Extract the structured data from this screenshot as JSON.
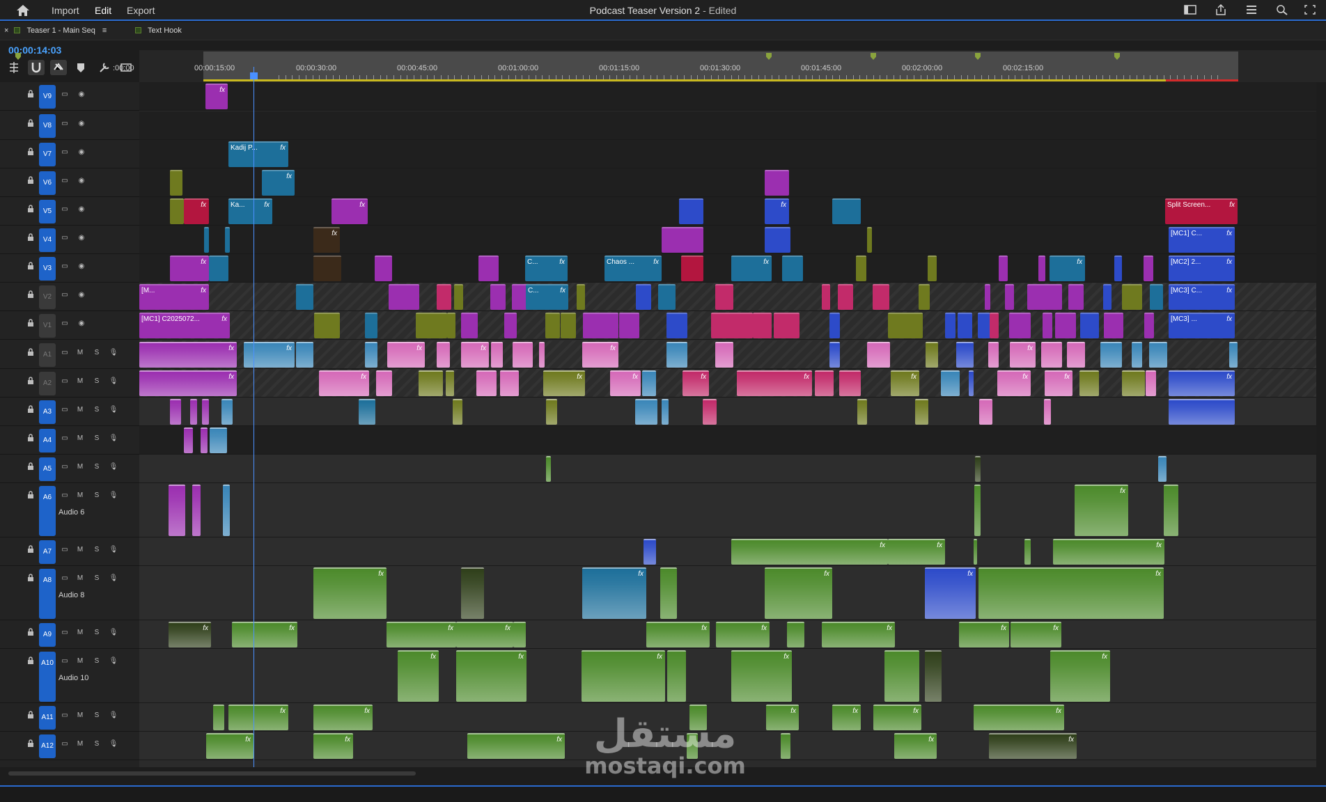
{
  "topbar": {
    "menus": [
      "Import",
      "Edit",
      "Export"
    ],
    "active_menu": "Edit",
    "title": "Podcast Teaser Version 2",
    "title_suffix": " - Edited"
  },
  "tabs": [
    {
      "label": "Teaser 1 - Main Seq",
      "active": true
    },
    {
      "label": "Text Hook",
      "active": false
    }
  ],
  "timecode": "00:00:14:03",
  "ruler_labels": [
    ":00:00",
    "00:00:15:00",
    "00:00:30:00",
    "00:00:45:00",
    "00:01:00:00",
    "00:01:15:00",
    "00:01:30:00",
    "00:01:45:00",
    "00:02:00:00",
    "00:02:15:00"
  ],
  "video_tracks": [
    "V9",
    "V8",
    "V7",
    "V6",
    "V5",
    "V4",
    "V3",
    "V2",
    "V1"
  ],
  "audio_tracks": [
    "A1",
    "A2",
    "A3",
    "A4",
    "A5",
    "A6",
    "A7",
    "A8",
    "A9",
    "A10",
    "A11",
    "A12"
  ],
  "track_subnames": {
    "A6": "Audio 6",
    "A8": "Audio 8",
    "A10": "Audio 10"
  },
  "clip_labels": {
    "v7": "Kadij P...",
    "v5a": "Ka...",
    "v5b": "Split Screen...",
    "v4": "[MC1] C...",
    "v3a": "C...",
    "v3b": "Chaos ...",
    "v3c": "[MC2] 2...",
    "v2a": "[M...",
    "v2b": "C...",
    "v2c": "[MC3] C...",
    "v1a": "[MC1] C2025072...",
    "v1b": "[MC3] ..."
  },
  "fx_label": "fx",
  "watermark": {
    "arabic": "مستقل",
    "latin": "mostaqi.com"
  },
  "colors": {
    "accent": "#1e63c9",
    "playhead": "#4a90ff"
  }
}
